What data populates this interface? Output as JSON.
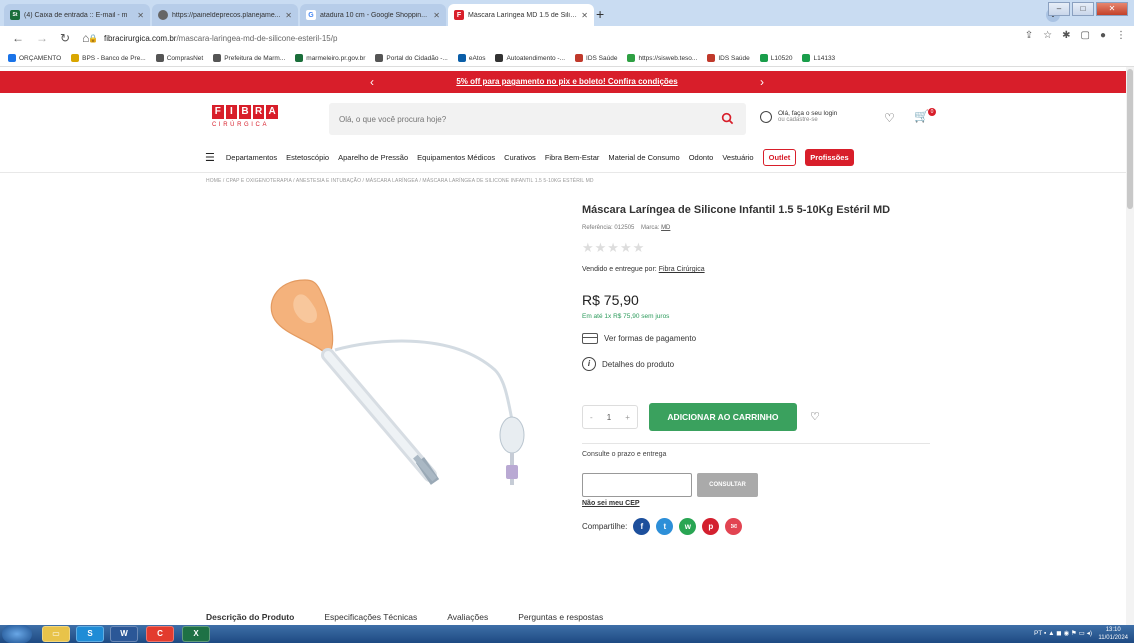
{
  "browser": {
    "tabs": [
      {
        "icon": "St",
        "icon_color": "#1a6e3a",
        "title": "(4) Caixa de entrada :: E-mail - m"
      },
      {
        "icon": "globe",
        "icon_color": "#666666",
        "title": "https://paineldeprecos.planejame..."
      },
      {
        "icon": "G",
        "icon_color": "#4285f4",
        "title": "atadura 10 cm - Google Shoppin..."
      },
      {
        "icon": "F",
        "icon_color": "#d81e2a",
        "title": "Máscara Laríngea MD 1.5 de Silic..."
      }
    ],
    "new_tab": "+",
    "url_host": "fibracirurgica.com.br",
    "url_path": "/mascara-laringea-md-de-silicone-esteril-15/p",
    "bookmarks": [
      {
        "label": "ORÇAMENTO",
        "color": "#1a73e8"
      },
      {
        "label": "BPS - Banco de Pre...",
        "color": "#d9a600"
      },
      {
        "label": "ComprasNet",
        "color": "#555555"
      },
      {
        "label": "Prefeitura de Marm...",
        "color": "#555555"
      },
      {
        "label": "marmeleiro.pr.gov.br",
        "color": "#1a6e3a"
      },
      {
        "label": "Portal do Cidadão -...",
        "color": "#555555"
      },
      {
        "label": "eAtos",
        "color": "#0a5ea8"
      },
      {
        "label": "Autoatendimento -...",
        "color": "#333333"
      },
      {
        "label": "IDS Saúde",
        "color": "#c0392b"
      },
      {
        "label": "https://sisweb.teso...",
        "color": "#2ea043"
      },
      {
        "label": "IDS Saúde",
        "color": "#c0392b"
      },
      {
        "label": "L10520",
        "color": "#1a9e4b"
      },
      {
        "label": "L14133",
        "color": "#1a9e4b"
      }
    ]
  },
  "promo": {
    "text": "5% off para pagamento no pix e boleto! Confira condições",
    "prev": "‹",
    "next": "›"
  },
  "header": {
    "logo_letters": [
      "F",
      "I",
      "B",
      "R",
      "A"
    ],
    "logo_sub": "CIRÚRGICA",
    "search_placeholder": "Olá, o que você procura hoje?",
    "login_line1": "Olá, faça o seu login",
    "login_line2": "ou cadastre-se",
    "cart_count": "0"
  },
  "nav": {
    "items": [
      "Departamentos",
      "Estetoscópio",
      "Aparelho de Pressão",
      "Equipamentos Médicos",
      "Curativos",
      "Fibra Bem-Estar",
      "Material de Consumo",
      "Odonto",
      "Vestuário"
    ],
    "outlet": "Outlet",
    "profissoes": "Profissões"
  },
  "breadcrumb": "HOME / CPAP E OXIGENOTERAPIA / ANESTESIA E INTUBAÇÃO / MÁSCARA LARÍNGEA / MÁSCARA LARÍNGEA DE SILICONE INFANTIL 1.5 5-10KG ESTÉRIL MD",
  "product": {
    "title": "Máscara Laríngea de Silicone Infantil 1.5 5-10Kg Estéril MD",
    "ref_label": "Referência: 012505",
    "brand_label": "Marca:",
    "brand": "MD",
    "rating": 0,
    "seller_label": "Vendido e entregue por:",
    "seller": "Fibra Cirúrgica",
    "price": "R$ 75,90",
    "installment": "Em até 1x R$ 75,90 sem juros",
    "payment_link": "Ver formas de pagamento",
    "details_link": "Detalhes do produto",
    "qty_minus": "-",
    "qty": "1",
    "qty_plus": "+",
    "add_to_cart": "ADICIONAR AO CARRINHO",
    "consulte": "Consulte o prazo e entrega",
    "consultar": "CONSULTAR",
    "nao_sei": "Não sei meu CEP",
    "share_label": "Compartilhe:"
  },
  "share": [
    {
      "icon": "facebook-icon",
      "glyph": "f",
      "color": "#1d4f9c"
    },
    {
      "icon": "twitter-icon",
      "glyph": "t",
      "color": "#2d8fd8"
    },
    {
      "icon": "whatsapp-icon",
      "glyph": "w",
      "color": "#29a553"
    },
    {
      "icon": "pinterest-icon",
      "glyph": "p",
      "color": "#d3202f"
    },
    {
      "icon": "email-icon",
      "glyph": "✉",
      "color": "#e24452"
    }
  ],
  "tabs": [
    "Descrição do Produto",
    "Especificações Técnicas",
    "Avaliações",
    "Perguntas e respostas"
  ],
  "taskbar": {
    "apps": [
      "S",
      "W",
      "C",
      "X"
    ],
    "tray": "PT",
    "time": "13:10",
    "date": "11/01/2024"
  }
}
